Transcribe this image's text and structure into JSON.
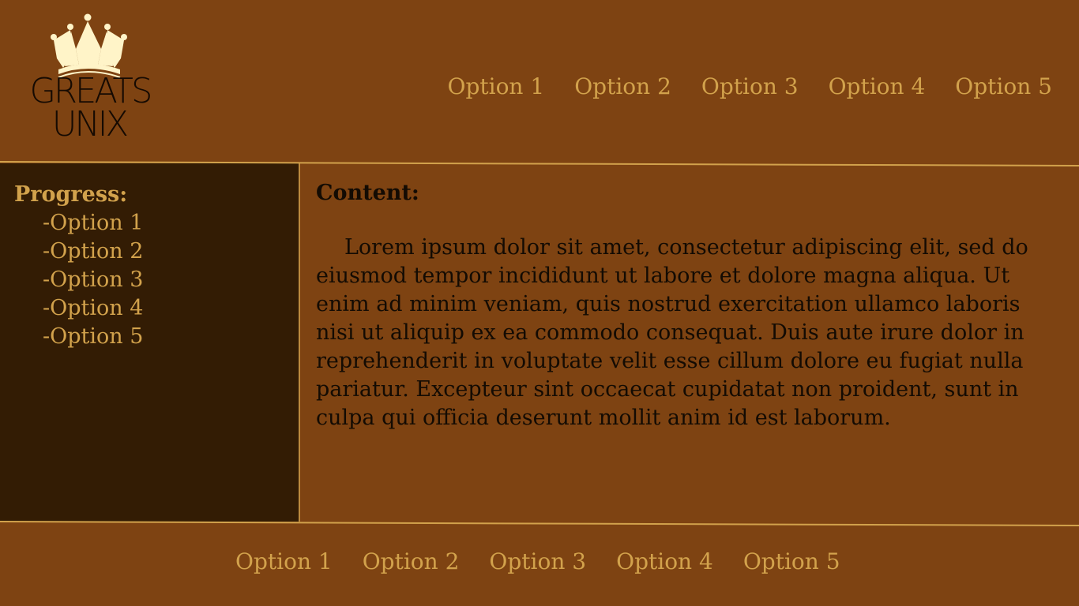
{
  "logo": {
    "line1": "GREATS",
    "line2": "UNIX",
    "icon": "crown-icon"
  },
  "top_nav": {
    "items": [
      "Option 1",
      "Option 2",
      "Option 3",
      "Option 4",
      "Option 5"
    ]
  },
  "sidebar": {
    "title": "Progress:",
    "items": [
      "-Option 1",
      "-Option 2",
      "-Option 3",
      "-Option 4",
      "-Option 5"
    ]
  },
  "content": {
    "title": "Content:",
    "body": "Lorem ipsum dolor sit amet, consectetur adipiscing elit, sed do eiusmod tempor incididunt ut labore et dolore magna aliqua. Ut enim ad minim veniam, quis nostrud exercitation ullamco laboris nisi ut aliquip ex ea commodo consequat. Duis aute irure dolor in reprehenderit in voluptate velit esse cillum dolore eu fugiat nulla pariatur. Excepteur sint occaecat cupidatat non proident, sunt in culpa qui officia deserunt mollit anim id est laborum."
  },
  "footer_nav": {
    "items": [
      "Option 1",
      "Option 2",
      "Option 3",
      "Option 4",
      "Option 5"
    ]
  },
  "colors": {
    "background": "#7e4312",
    "sidebar_background": "#331c04",
    "accent": "#d2a24c",
    "text": "#130b03",
    "crown": "#fff4c8"
  }
}
